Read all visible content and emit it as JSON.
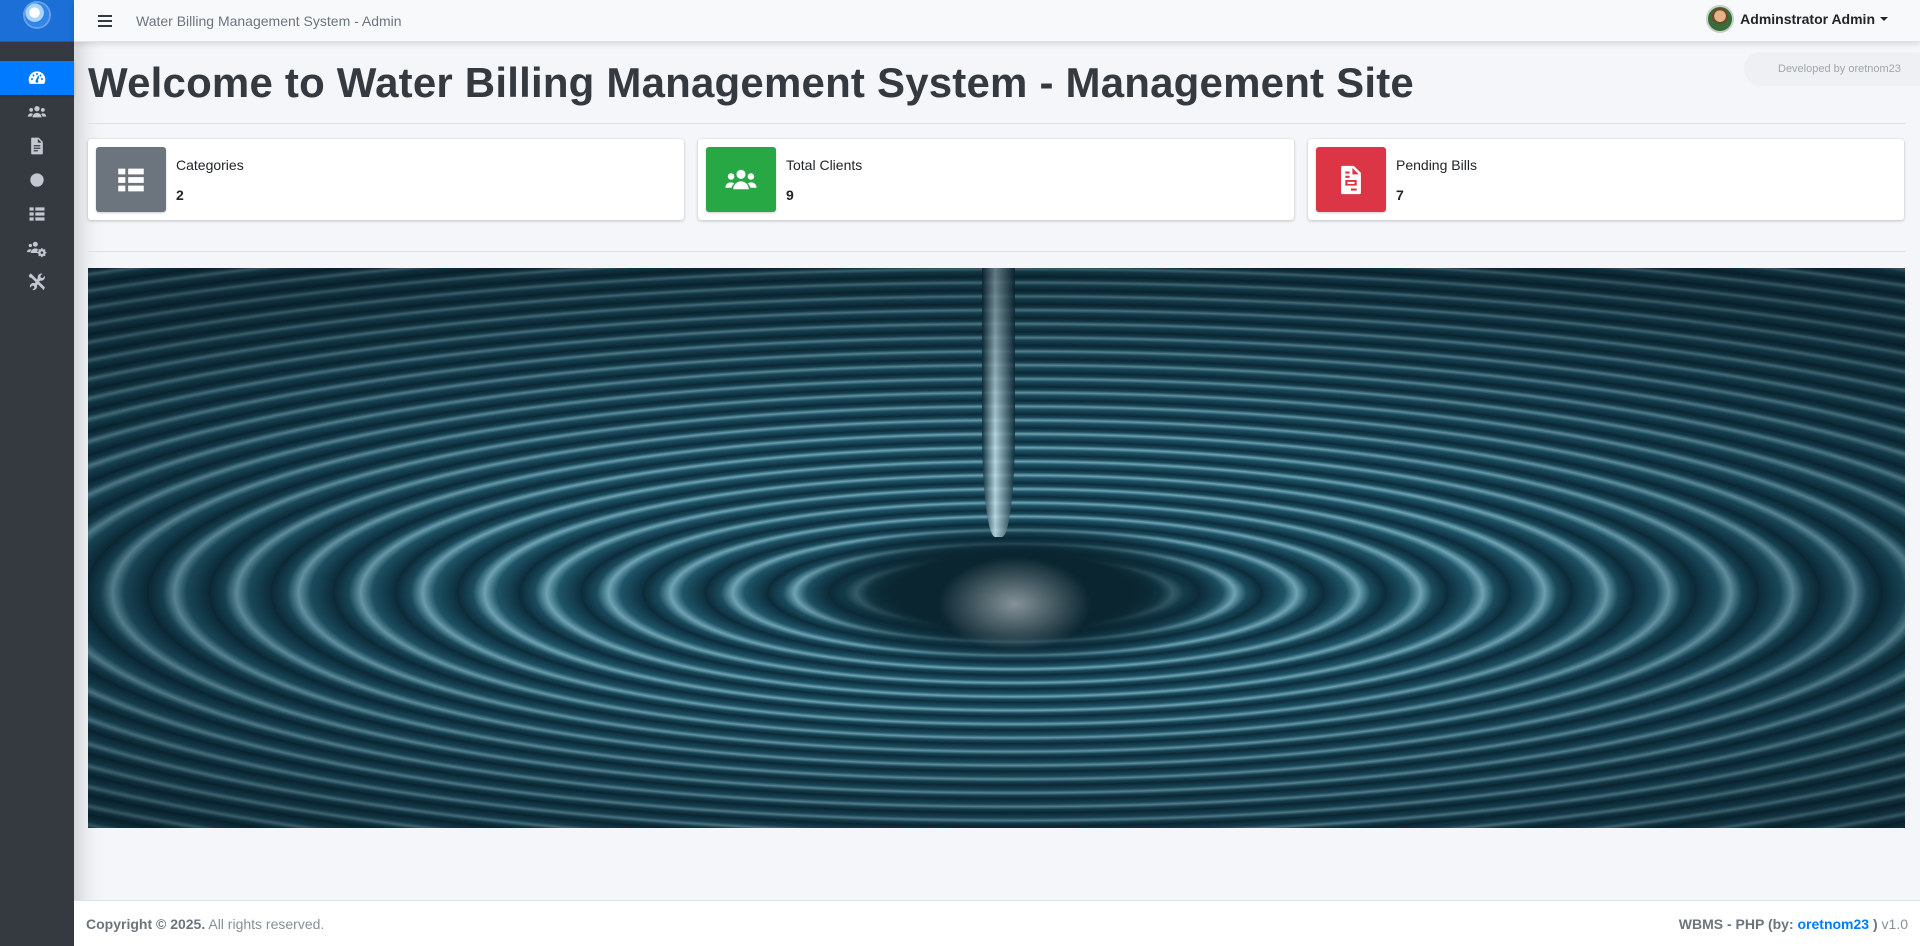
{
  "app": {
    "top_title": "Water Billing Management System - Admin"
  },
  "user": {
    "name": "Adminstrator Admin"
  },
  "sidebar": {
    "items": [
      {
        "name": "dashboard",
        "icon": "tachometer-icon",
        "active": true
      },
      {
        "name": "clients",
        "icon": "users-icon",
        "active": false
      },
      {
        "name": "billing",
        "icon": "file-icon",
        "active": false
      },
      {
        "name": "circle",
        "icon": "circle-icon",
        "active": false
      },
      {
        "name": "categories",
        "icon": "th-list-icon",
        "active": false
      },
      {
        "name": "user-management",
        "icon": "users-cog-icon",
        "active": false
      },
      {
        "name": "settings",
        "icon": "tools-icon",
        "active": false
      }
    ]
  },
  "main": {
    "title": "Welcome to Water Billing Management System - Management Site",
    "dev_badge": "Developed by oretnom23",
    "cards": [
      {
        "label": "Categories",
        "value": "2",
        "icon": "th-list-icon",
        "color": "#6c757d"
      },
      {
        "label": "Total Clients",
        "value": "9",
        "icon": "users-icon",
        "color": "#28a745"
      },
      {
        "label": "Pending Bills",
        "value": "7",
        "icon": "file-invoice-icon",
        "color": "#dc3545"
      }
    ]
  },
  "footer": {
    "copyright": "Copyright © 2025.",
    "rights": "All rights reserved.",
    "app_prefix": "WBMS - PHP (by: ",
    "author": "oretnom23",
    "app_suffix": " )",
    "version": "v1.0"
  }
}
